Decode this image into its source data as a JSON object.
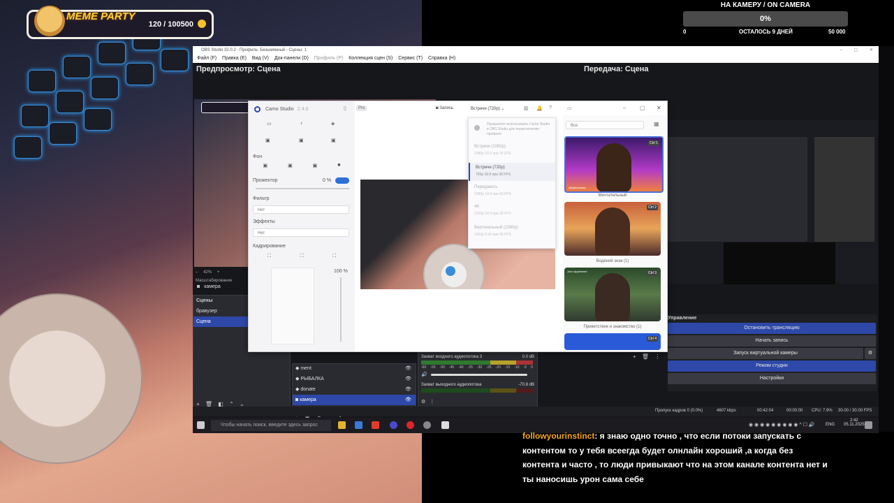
{
  "meme_party": {
    "title": "MEME PARTY",
    "count": "120 / 100500"
  },
  "goal": {
    "title": "НА КАМЕРУ / ON CAMERA",
    "percent": "0%",
    "progress": 0,
    "min": "0",
    "remaining": "ОСТАЛОСЬ 9 ДНЕЙ",
    "max": "50 000"
  },
  "obs": {
    "title": "OBS Studio 32.0.2 - Профиль: Безымянный - Сцены: 1",
    "menu": [
      "Файл (F)",
      "Правка (E)",
      "Вид (V)",
      "Док-панели (D)",
      "Профиль (P)",
      "Коллекция сцен (S)",
      "Сервис (T)",
      "Справка (H)"
    ],
    "preview_title": "Предпросмотр: Сцена",
    "program_title": "Передача: Сцена",
    "zoom": "42%",
    "zoom_label": "Масштабирование",
    "source_selected": "камера",
    "scenes_title": "Сцены",
    "scenes": [
      "бравузер",
      "Сцена"
    ],
    "sources": [
      "ment",
      "РЫБАЛКА",
      "donate",
      "камера"
    ],
    "audio": [
      {
        "name": "Захват входного аудиопотока 3",
        "level": "0.0 dB"
      },
      {
        "name": "Захват выходного аудиопотока",
        "level": "-70.8 dB"
      }
    ],
    "meter_ticks": [
      "-60",
      "-55",
      "-50",
      "-45",
      "-40",
      "-35",
      "-30",
      "-25",
      "-20",
      "-15",
      "-10",
      "-5",
      "0"
    ],
    "controls_title": "Управление",
    "controls": [
      "Остановить трансляцию",
      "Начать запись",
      "Запуск виртуальной камеры",
      "Режим студии",
      "Настройки"
    ],
    "status": {
      "dropped": "Пропуск кадров 0 (0.0%)",
      "bitrate": "4607 kbps",
      "stream_time": "00:42:04",
      "rec_time": "00:00:00",
      "cpu": "CPU: 7.9%",
      "fps": "30.00 / 30.00 FPS"
    }
  },
  "taskbar": {
    "search_placeholder": "Чтобы начать поиск, введите здесь запрос",
    "lang": "ENG",
    "time": "2:42",
    "date": "05.11.2025"
  },
  "camo": {
    "title": "Camo Studio",
    "version": "2.4.0",
    "pro": "Pro",
    "record": "Запись",
    "quality": "Встречи (720р)",
    "fon_label": "Фон",
    "spotlight_label": "Прожектор",
    "spotlight_value": "0 %",
    "filter_label": "Фильтр",
    "filter_value": "Нет",
    "effects_label": "Эффекты",
    "effects_value": "Нет",
    "crop_label": "Кадрирование",
    "zoom_value": "100 %",
    "dropdown_notice": "Прекратите использовать Camo Studio в OBS Studio для переключения профиля",
    "dropdown_options": [
      {
        "label": "Встречи (1080р)",
        "sub": "1080р 16:9 при 30 FPS"
      },
      {
        "label": "Встречи (720р)",
        "sub": "720р 16:9 при 30 FPS"
      },
      {
        "label": "Передавать",
        "sub": "1080р 16:9 при 60 FPS"
      },
      {
        "label": "4K",
        "sub": "2160р 16:9 при 30 FPS"
      },
      {
        "label": "Вертикальный (1080р)",
        "sub": "1920р 9:16 при 30 FPS"
      }
    ],
    "bg_filter": "Все",
    "backgrounds": [
      {
        "caption": "Мечтательный",
        "key": "Ctrl 1",
        "name_tag": "@kjabbaaaaa"
      },
      {
        "caption": "Водяной знак (1)",
        "key": "Ctrl 2"
      },
      {
        "caption": "Приветствие и знакомство (1)",
        "key": "Ctrl 3",
        "name_tag": "John Appleseed"
      },
      {
        "caption": "",
        "key": "Ctrl 4"
      }
    ]
  },
  "chat": {
    "user": "followyourinstinct",
    "message": ": я знаю одно точно , что если потоки запускать с контентом то у тебя всеегда будет олнлайн хороший ,а когда без контента и часто , то люди привыкают что на этом канале контента нет и ты наносишь урон сама себе"
  },
  "colors": {
    "obs_accent": "#2d48a8",
    "chat_user": "#f5a623",
    "meme_title": "#ffce3a"
  }
}
